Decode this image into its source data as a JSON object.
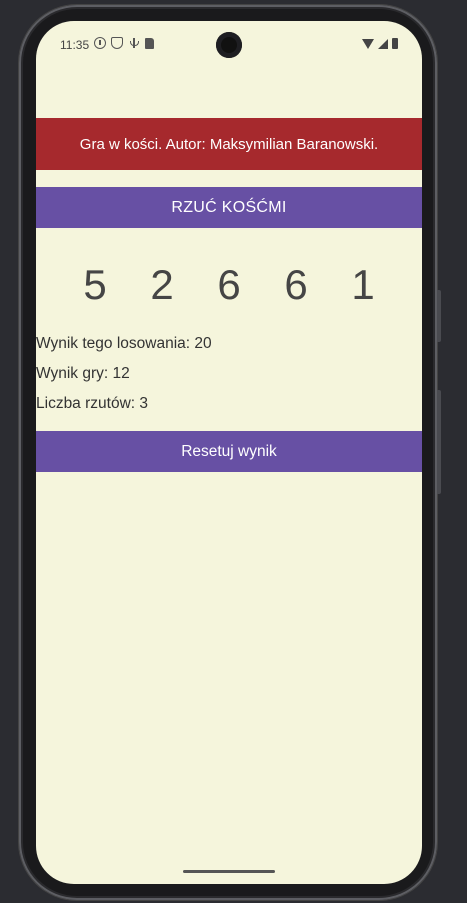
{
  "status_bar": {
    "time": "11:35",
    "left_icons": [
      "info-icon",
      "shield-icon",
      "usb-icon",
      "sd-card-icon"
    ],
    "right_icons": [
      "wifi-icon",
      "cell-signal-icon",
      "battery-icon"
    ]
  },
  "app": {
    "header_text": "Gra w kości. Autor: Maksymilian Baranowski.",
    "roll_button_label": "RZUĆ KOŚĆMI",
    "dice": [
      "5",
      "2",
      "6",
      "6",
      "1"
    ],
    "stats": {
      "roll_score": "Wynik tego losowania: 20",
      "game_score": "Wynik gry: 12",
      "roll_count": "Liczba rzutów: 3"
    },
    "reset_button_label": "Resetuj wynik"
  },
  "colors": {
    "header_bg": "#a6292d",
    "button_bg": "#6750a4",
    "screen_bg": "#f5f5dc"
  }
}
